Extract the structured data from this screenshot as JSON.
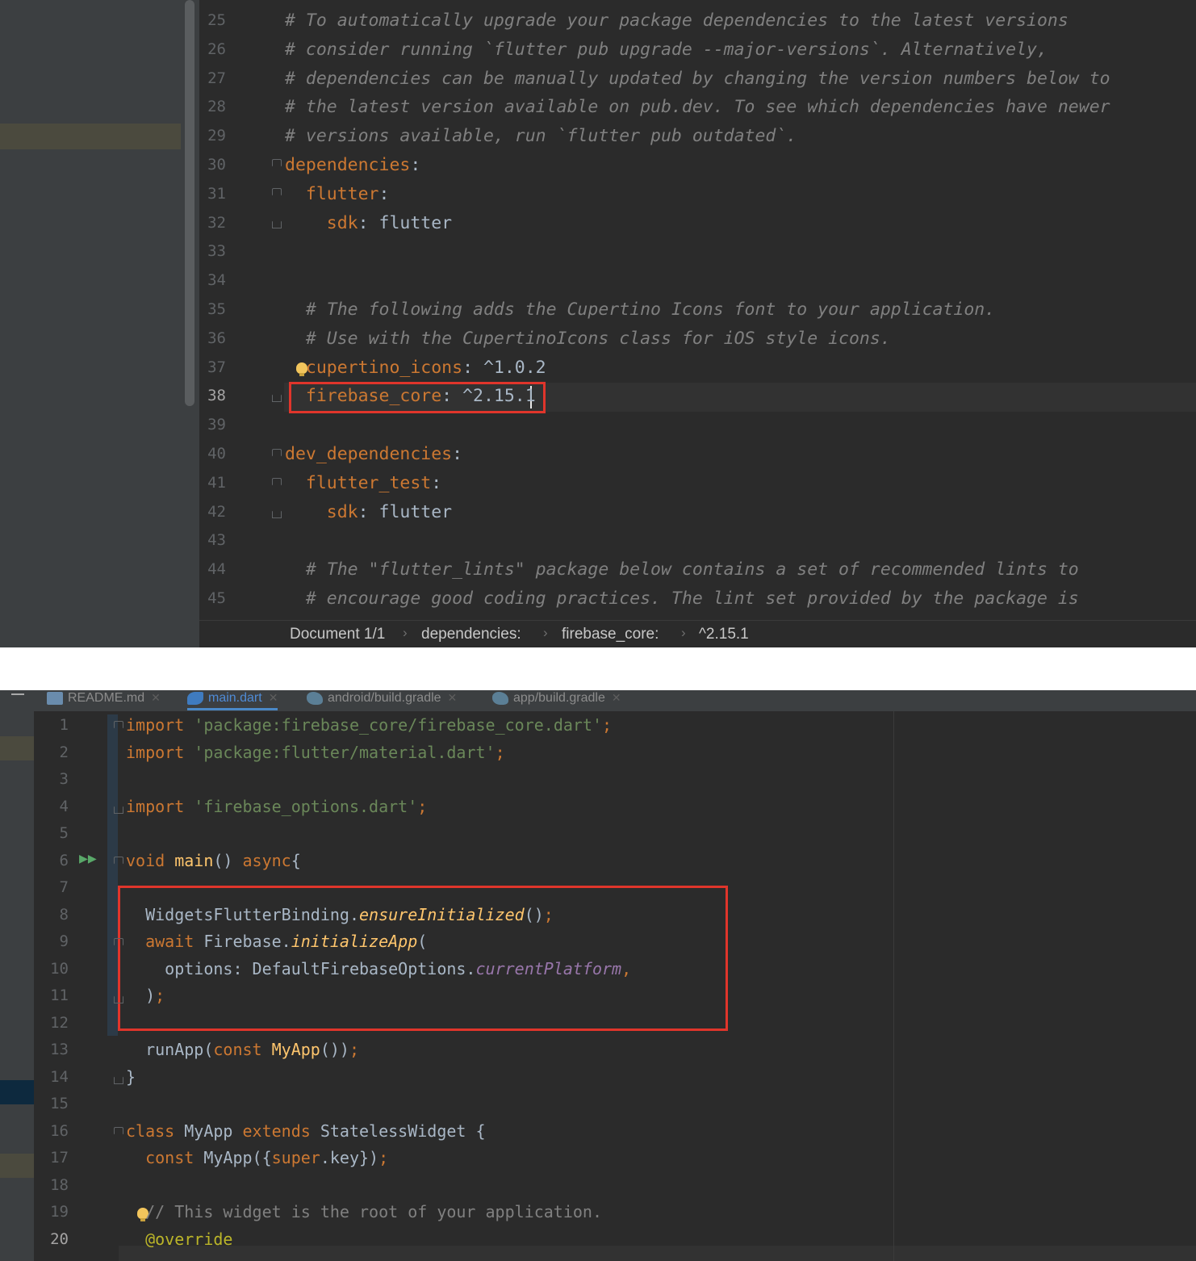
{
  "top_editor": {
    "lines": [
      {
        "n": "25",
        "segs": [
          {
            "t": "# To automatically upgrade your package dependencies to the latest versions",
            "c": "c-comment"
          }
        ]
      },
      {
        "n": "26",
        "segs": [
          {
            "t": "# consider running `flutter pub upgrade --major-versions`. Alternatively,",
            "c": "c-comment"
          }
        ]
      },
      {
        "n": "27",
        "segs": [
          {
            "t": "# dependencies can be manually updated by changing the version numbers below to",
            "c": "c-comment"
          }
        ]
      },
      {
        "n": "28",
        "segs": [
          {
            "t": "# the latest version available on pub.dev. To see which dependencies have newer",
            "c": "c-comment"
          }
        ]
      },
      {
        "n": "29",
        "segs": [
          {
            "t": "# versions available, run `flutter pub outdated`.",
            "c": "c-comment"
          }
        ]
      },
      {
        "n": "30",
        "segs": [
          {
            "t": "dependencies",
            "c": "c-key"
          },
          {
            "t": ":",
            "c": "c-text"
          }
        ]
      },
      {
        "n": "31",
        "segs": [
          {
            "t": "  flutter",
            "c": "c-key"
          },
          {
            "t": ":",
            "c": "c-text"
          }
        ]
      },
      {
        "n": "32",
        "segs": [
          {
            "t": "    sdk",
            "c": "c-key"
          },
          {
            "t": ": flutter",
            "c": "c-text"
          }
        ]
      },
      {
        "n": "33",
        "segs": []
      },
      {
        "n": "34",
        "segs": []
      },
      {
        "n": "35",
        "segs": [
          {
            "t": "  # The following adds the Cupertino Icons font to your application.",
            "c": "c-comment"
          }
        ]
      },
      {
        "n": "36",
        "segs": [
          {
            "t": "  # Use with the CupertinoIcons class for iOS style icons.",
            "c": "c-comment"
          }
        ]
      },
      {
        "n": "37",
        "segs": [
          {
            "t": "  cupertino_icons",
            "c": "c-key"
          },
          {
            "t": ": ^1.0.2",
            "c": "c-text"
          }
        ]
      },
      {
        "n": "38",
        "segs": [
          {
            "t": "  firebase_core",
            "c": "c-key"
          },
          {
            "t": ": ^2.15.1",
            "c": "c-text"
          }
        ]
      },
      {
        "n": "39",
        "segs": []
      },
      {
        "n": "40",
        "segs": [
          {
            "t": "dev_dependencies",
            "c": "c-key"
          },
          {
            "t": ":",
            "c": "c-text"
          }
        ]
      },
      {
        "n": "41",
        "segs": [
          {
            "t": "  flutter_test",
            "c": "c-key"
          },
          {
            "t": ":",
            "c": "c-text"
          }
        ]
      },
      {
        "n": "42",
        "segs": [
          {
            "t": "    sdk",
            "c": "c-key"
          },
          {
            "t": ": flutter",
            "c": "c-text"
          }
        ]
      },
      {
        "n": "43",
        "segs": []
      },
      {
        "n": "44",
        "segs": [
          {
            "t": "  # The \"flutter_lints\" package below contains a set of recommended lints to",
            "c": "c-comment"
          }
        ]
      },
      {
        "n": "45",
        "segs": [
          {
            "t": "  # encourage good coding practices. The lint set provided by the package is",
            "c": "c-comment"
          }
        ]
      }
    ],
    "current_line": "38",
    "breadcrumb": [
      "Document 1/1",
      "dependencies:",
      "firebase_core:",
      "^2.15.1"
    ]
  },
  "bottom_editor": {
    "tabs": [
      {
        "label": "README.md",
        "icon": "markdown-file-icon",
        "active": false
      },
      {
        "label": "main.dart",
        "icon": "dart-file-icon",
        "active": true
      },
      {
        "label": "android/build.gradle",
        "icon": "gradle-file-icon",
        "active": false
      },
      {
        "label": "app/build.gradle",
        "icon": "gradle-file-icon",
        "active": false
      }
    ],
    "lines": [
      {
        "n": "1",
        "segs": [
          {
            "t": "import ",
            "c": "c-key"
          },
          {
            "t": "'package:firebase_core/firebase_core.dart'",
            "c": "c-str"
          },
          {
            "t": ";",
            "c": "c-key"
          }
        ]
      },
      {
        "n": "2",
        "segs": [
          {
            "t": "import ",
            "c": "c-key"
          },
          {
            "t": "'package:flutter/material.dart'",
            "c": "c-str"
          },
          {
            "t": ";",
            "c": "c-key"
          }
        ]
      },
      {
        "n": "3",
        "segs": []
      },
      {
        "n": "4",
        "segs": [
          {
            "t": "import ",
            "c": "c-key"
          },
          {
            "t": "'firebase_options.dart'",
            "c": "c-str"
          },
          {
            "t": ";",
            "c": "c-key"
          }
        ]
      },
      {
        "n": "5",
        "segs": []
      },
      {
        "n": "6",
        "segs": [
          {
            "t": "void ",
            "c": "c-key"
          },
          {
            "t": "main",
            "c": "c-fn"
          },
          {
            "t": "() ",
            "c": "c-text"
          },
          {
            "t": "async",
            "c": "c-key"
          },
          {
            "t": "{",
            "c": "c-text"
          }
        ]
      },
      {
        "n": "7",
        "segs": []
      },
      {
        "n": "8",
        "segs": [
          {
            "t": "  WidgetsFlutterBinding.",
            "c": "c-text"
          },
          {
            "t": "ensureInitialized",
            "c": "c-italicfn"
          },
          {
            "t": "()",
            "c": "c-text"
          },
          {
            "t": ";",
            "c": "c-key"
          }
        ]
      },
      {
        "n": "9",
        "segs": [
          {
            "t": "  await ",
            "c": "c-key"
          },
          {
            "t": "Firebase.",
            "c": "c-text"
          },
          {
            "t": "initializeApp",
            "c": "c-italicfn"
          },
          {
            "t": "(",
            "c": "c-text"
          }
        ]
      },
      {
        "n": "10",
        "segs": [
          {
            "t": "    options: DefaultFirebaseOptions.",
            "c": "c-text"
          },
          {
            "t": "currentPlatform",
            "c": "c-field"
          },
          {
            "t": ",",
            "c": "c-key"
          }
        ]
      },
      {
        "n": "11",
        "segs": [
          {
            "t": "  )",
            "c": "c-text"
          },
          {
            "t": ";",
            "c": "c-key"
          }
        ]
      },
      {
        "n": "12",
        "segs": []
      },
      {
        "n": "13",
        "segs": [
          {
            "t": "  runApp(",
            "c": "c-text"
          },
          {
            "t": "const ",
            "c": "c-key"
          },
          {
            "t": "MyApp",
            "c": "c-fn"
          },
          {
            "t": "())",
            "c": "c-text"
          },
          {
            "t": ";",
            "c": "c-key"
          }
        ]
      },
      {
        "n": "14",
        "segs": [
          {
            "t": "}",
            "c": "c-text"
          }
        ]
      },
      {
        "n": "15",
        "segs": []
      },
      {
        "n": "16",
        "segs": [
          {
            "t": "class ",
            "c": "c-key"
          },
          {
            "t": "MyApp ",
            "c": "c-text"
          },
          {
            "t": "extends ",
            "c": "c-key"
          },
          {
            "t": "StatelessWidget {",
            "c": "c-text"
          }
        ]
      },
      {
        "n": "17",
        "segs": [
          {
            "t": "  const ",
            "c": "c-key"
          },
          {
            "t": "MyApp({",
            "c": "c-text"
          },
          {
            "t": "super",
            "c": "c-key"
          },
          {
            "t": ".key})",
            "c": "c-text"
          },
          {
            "t": ";",
            "c": "c-key"
          }
        ]
      },
      {
        "n": "18",
        "segs": []
      },
      {
        "n": "19",
        "segs": [
          {
            "t": "  // This widget is the root of your application.",
            "c": "c-comment-plain"
          }
        ]
      },
      {
        "n": "20",
        "segs": [
          {
            "t": "  @override",
            "c": "c-anno"
          }
        ]
      }
    ],
    "current_line": "20"
  },
  "colors": {
    "editor_bg": "#2b2b2b",
    "gutter_bg": "#313335",
    "highlight_border": "#e0352b",
    "keyword": "#cc7832",
    "comment": "#808080",
    "string": "#6a8759",
    "active_tab": "#4f8bd6"
  }
}
